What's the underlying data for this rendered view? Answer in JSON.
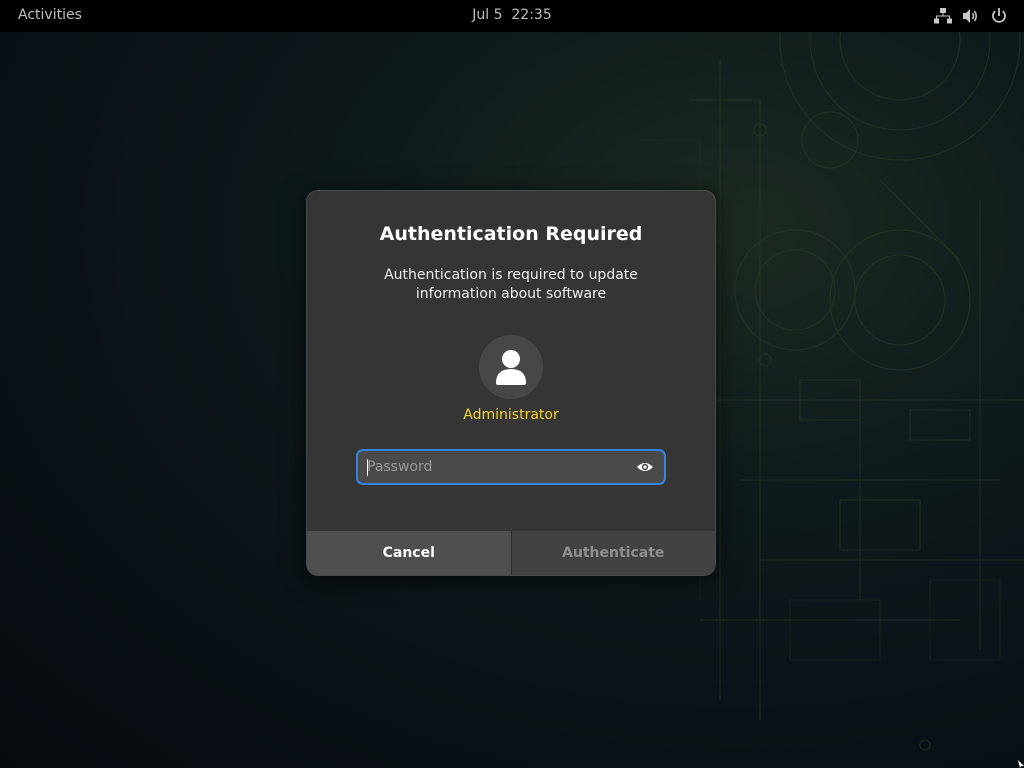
{
  "topbar": {
    "activities_label": "Activities",
    "clock": "Jul 5  22:35",
    "tray_icons": [
      "network-icon",
      "volume-icon",
      "power-icon"
    ]
  },
  "dialog": {
    "title": "Authentication Required",
    "description": "Authentication is required to update information about software",
    "user": {
      "avatar_icon": "user-avatar-icon",
      "name": "Administrator"
    },
    "password": {
      "placeholder": "Password",
      "value": "",
      "reveal_icon": "eye-icon"
    },
    "buttons": {
      "cancel_label": "Cancel",
      "authenticate_label": "Authenticate"
    }
  },
  "colors": {
    "topbar_bg": "#000000",
    "dialog_bg": "#353535",
    "user_name": "#f6d32d",
    "focus_ring": "#3584e4",
    "authenticate_disabled_text": "#8f8f8f"
  }
}
